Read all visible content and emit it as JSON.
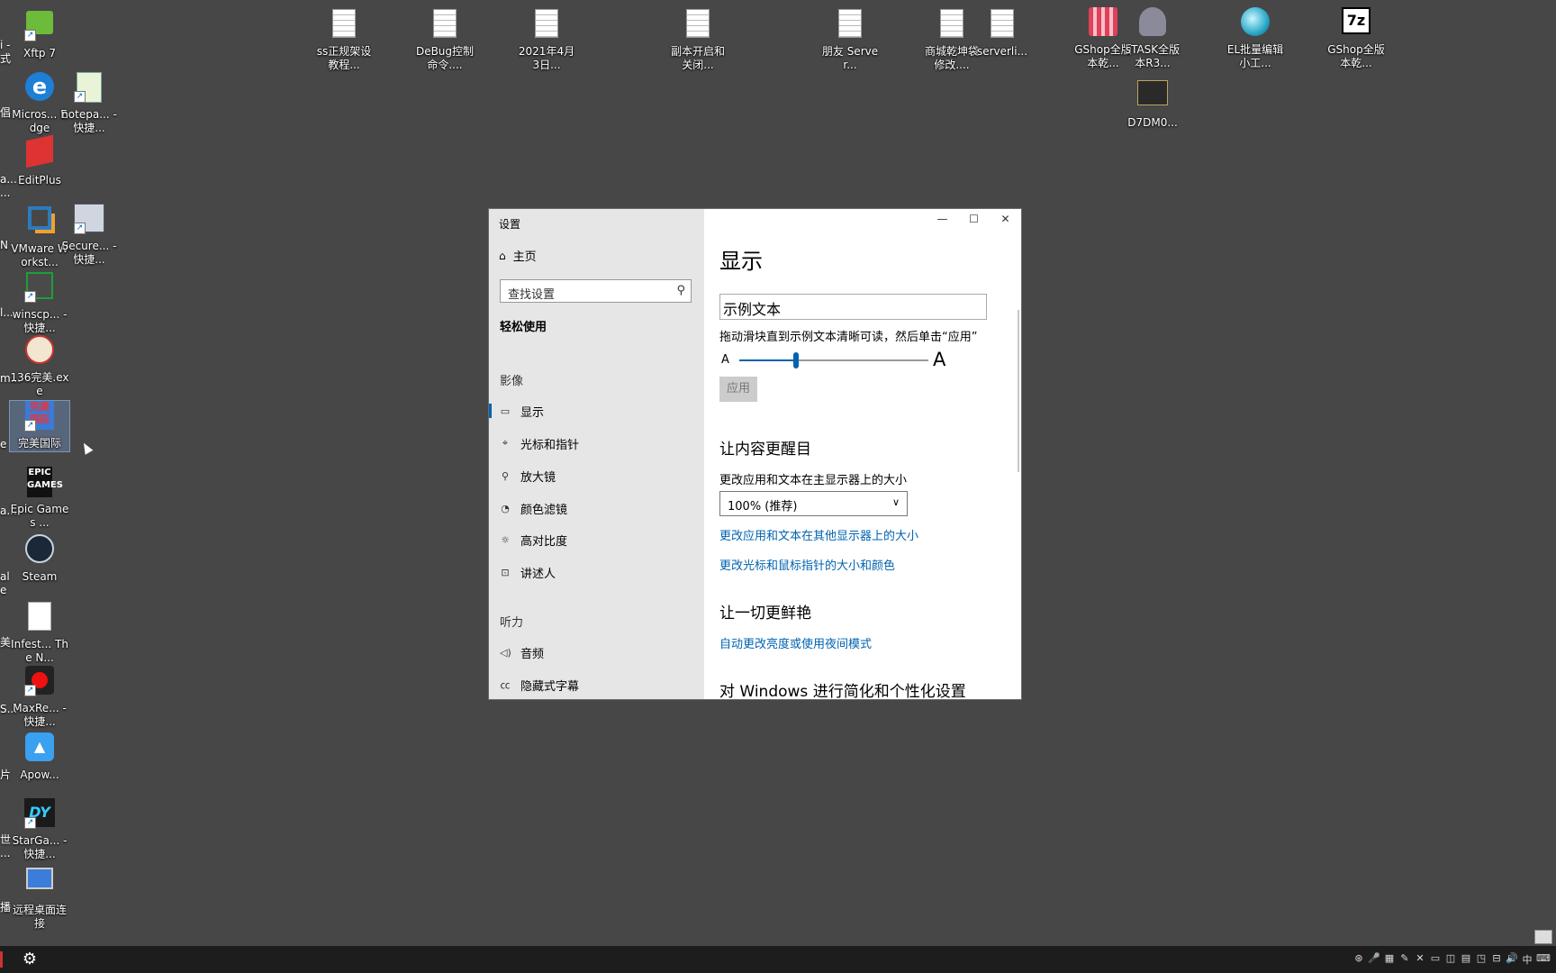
{
  "desktop": {
    "icons": [
      {
        "label": "Xftp 7",
        "icon": "xftp-icon"
      },
      {
        "label": "Micros... Edge",
        "icon": "edge-icon"
      },
      {
        "label": "notepa... - 快捷...",
        "icon": "notepad-icon"
      },
      {
        "label": "EditPlus",
        "icon": "editplus-icon"
      },
      {
        "label": "VMware Workst...",
        "icon": "vmware-icon"
      },
      {
        "label": "Secure... - 快捷...",
        "icon": "securecrt-icon"
      },
      {
        "label": "winscp... - 快捷...",
        "icon": "winscp-icon"
      },
      {
        "label": "136完美.exe",
        "icon": "game-exe-icon"
      },
      {
        "label": "完美国际",
        "icon": "perfect-world-icon"
      },
      {
        "label": "Epic Games ...",
        "icon": "epic-games-icon"
      },
      {
        "label": "Steam",
        "icon": "steam-icon"
      },
      {
        "label": "Infest... The N...",
        "icon": "file-icon"
      },
      {
        "label": "MaxRe... - 快捷...",
        "icon": "maxrecorder-icon"
      },
      {
        "label": "Apow...",
        "icon": "apowersoft-icon"
      },
      {
        "label": "StarGa... - 快捷...",
        "icon": "stargame-icon"
      },
      {
        "label": "远程桌面连接",
        "icon": "remote-desktop-icon"
      },
      {
        "label": "ss正规架设教程...",
        "icon": "text-file-icon"
      },
      {
        "label": "DeBug控制命令....",
        "icon": "text-file-icon"
      },
      {
        "label": "2021年4月3日...",
        "icon": "text-file-icon"
      },
      {
        "label": "副本开启和关闭...",
        "icon": "text-file-icon"
      },
      {
        "label": "朋友 Server...",
        "icon": "text-file-icon"
      },
      {
        "label": "商城乾坤袋修改....",
        "icon": "text-file-icon"
      },
      {
        "label": "serverli...",
        "icon": "text-file-icon"
      },
      {
        "label": "GShop全版本乾...",
        "icon": "gshop-icon"
      },
      {
        "label": "sTASK全版本R3...",
        "icon": "stask-icon"
      },
      {
        "label": "EL批量编辑小工...",
        "icon": "el-editor-icon"
      },
      {
        "label": "GShop全版本乾...",
        "icon": "7z-archive-icon"
      },
      {
        "label": "D7DM0...",
        "icon": "image-file-icon"
      }
    ],
    "edge_fragments": [
      "i -",
      "式",
      "倡",
      "a...",
      "...",
      "N",
      "l...",
      "m...",
      "e",
      "a...",
      "al",
      "e",
      "美",
      "S...",
      "片",
      "世",
      "...",
      "播"
    ]
  },
  "window": {
    "title": "设置",
    "controls": {
      "minimize": "—",
      "maximize": "☐",
      "close": "✕"
    },
    "sidebar": {
      "home_label": "主页",
      "search_placeholder": "查找设置",
      "category": "轻松使用",
      "section_vision": "影像",
      "section_hearing": "听力",
      "items": [
        {
          "label": "显示",
          "icon": "monitor-icon",
          "glyph": "▭",
          "active": true
        },
        {
          "label": "光标和指针",
          "icon": "cursor-icon",
          "glyph": "⌖",
          "active": false
        },
        {
          "label": "放大镜",
          "icon": "magnifier-icon",
          "glyph": "⚲",
          "active": false
        },
        {
          "label": "颜色滤镜",
          "icon": "color-filter-icon",
          "glyph": "◔",
          "active": false
        },
        {
          "label": "高对比度",
          "icon": "contrast-icon",
          "glyph": "☼",
          "active": false
        },
        {
          "label": "讲述人",
          "icon": "narrator-icon",
          "glyph": "⊡",
          "active": false
        },
        {
          "label": "音频",
          "icon": "speaker-icon",
          "glyph": "◁)",
          "active": false
        },
        {
          "label": "隐藏式字幕",
          "icon": "caption-icon",
          "glyph": "㏄",
          "active": false
        }
      ]
    },
    "main": {
      "heading": "显示",
      "sample_text": "示例文本",
      "slider_hint": "拖动滑块直到示例文本清晰可读，然后单击“应用”",
      "slider_small_label": "A",
      "slider_large_label": "A",
      "slider_value": 0.3,
      "apply_label": "应用",
      "section1_title": "让内容更醒目",
      "scale_label": "更改应用和文本在主显示器上的大小",
      "scale_value": "100% (推荐)",
      "link_other_displays": "更改应用和文本在其他显示器上的大小",
      "link_cursor": "更改光标和鼠标指针的大小和颜色",
      "section2_title": "让一切更鲜艳",
      "link_night": "自动更改亮度或使用夜间模式",
      "section3_title": "对 Windows 进行简化和个性化设置"
    }
  },
  "taskbar": {
    "settings_icon": "gear-icon",
    "tray": [
      "⊛",
      "🎤",
      "▦",
      "✎",
      "✕",
      "▭",
      "◫",
      "▤",
      "◳",
      "⊟",
      "🔊",
      "中",
      "⌨"
    ]
  },
  "colors": {
    "accent": "#0063b1",
    "desktop": "#474747",
    "sidebar": "#e6e6e6",
    "taskbar": "#1d1d1d"
  }
}
